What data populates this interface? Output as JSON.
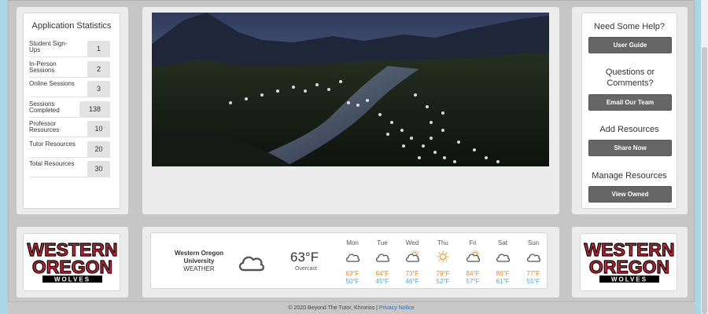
{
  "stats": {
    "title": "Application Statistics",
    "rows": [
      {
        "label": "Student Sign-Ups",
        "value": "1"
      },
      {
        "label": "In-Person Sessions",
        "value": "2"
      },
      {
        "label": "Online Sessions",
        "value": "3"
      },
      {
        "label": "Sessions Completed",
        "value": "138"
      },
      {
        "label": "Professor Resources",
        "value": "10"
      },
      {
        "label": "Tutor Resources",
        "value": "20"
      },
      {
        "label": "Total Resources",
        "value": "30"
      }
    ]
  },
  "help": {
    "need_help": "Need Some Help?",
    "user_guide": "User Guide",
    "questions": "Questions or Comments?",
    "email_team": "Email Our Team",
    "add_resources": "Add Resources",
    "share_now": "Share Now",
    "manage_resources": "Manage Resources",
    "view_owned": "View Owned"
  },
  "logo": {
    "line1": "WESTERN",
    "line2": "OREGON",
    "line3": "WOLVES",
    "color": "#d52030"
  },
  "weather": {
    "place_line1": "Western Oregon",
    "place_line2": "University",
    "label": "WEATHER",
    "current_temp": "63°F",
    "condition": "Overcast",
    "current_icon": "cloud-icon",
    "days": [
      {
        "name": "Mon",
        "icon": "cloud-icon",
        "hi": "63°F",
        "lo": "50°F"
      },
      {
        "name": "Tue",
        "icon": "cloud-icon",
        "hi": "64°F",
        "lo": "45°F"
      },
      {
        "name": "Wed",
        "icon": "partly-sunny-icon",
        "hi": "73°F",
        "lo": "46°F"
      },
      {
        "name": "Thu",
        "icon": "sun-icon",
        "hi": "79°F",
        "lo": "52°F"
      },
      {
        "name": "Fri",
        "icon": "partly-sunny-icon",
        "hi": "84°F",
        "lo": "57°F"
      },
      {
        "name": "Sat",
        "icon": "cloud-icon",
        "hi": "86°F",
        "lo": "61°F"
      },
      {
        "name": "Sun",
        "icon": "cloud-icon",
        "hi": "77°F",
        "lo": "55°F"
      }
    ],
    "hi_color": "#f0861a",
    "lo_color": "#49a7e3"
  },
  "footer": {
    "copyright": "© 2020 Beyond The Tutor, Khronos |",
    "privacy": "Privacy Notice"
  }
}
